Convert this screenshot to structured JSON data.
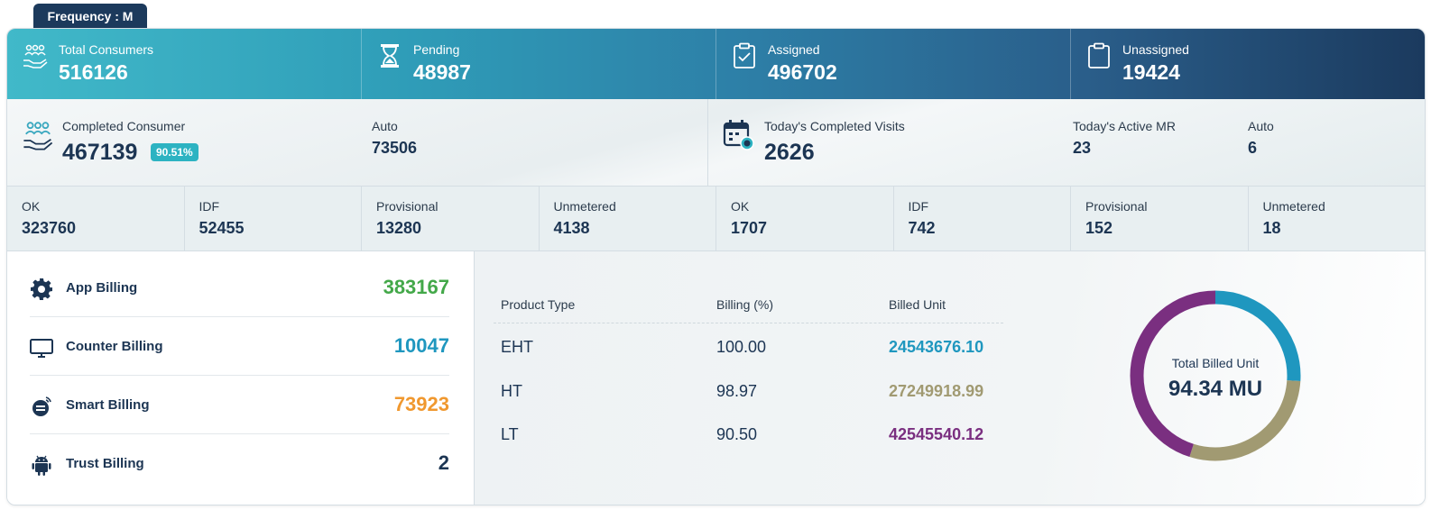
{
  "frequency_tab": "Frequency : M",
  "top_stats": [
    {
      "label": "Total Consumers",
      "value": "516126",
      "icon": "consumers-icon"
    },
    {
      "label": "Pending",
      "value": "48987",
      "icon": "hourglass-icon"
    },
    {
      "label": "Assigned",
      "value": "496702",
      "icon": "clipboard-check-icon"
    },
    {
      "label": "Unassigned",
      "value": "19424",
      "icon": "clipboard-empty-icon"
    }
  ],
  "summary": {
    "completed_label": "Completed Consumer",
    "completed_value": "467139",
    "completed_pct": "90.51%",
    "auto_label": "Auto",
    "auto_value": "73506",
    "visits_label": "Today's Completed Visits",
    "visits_value": "2626",
    "active_mr_label": "Today's Active MR",
    "active_mr_value": "23",
    "auto2_label": "Auto",
    "auto2_value": "6"
  },
  "status_row": [
    {
      "label": "OK",
      "value": "323760"
    },
    {
      "label": "IDF",
      "value": "52455"
    },
    {
      "label": "Provisional",
      "value": "13280"
    },
    {
      "label": "Unmetered",
      "value": "4138"
    },
    {
      "label": "OK",
      "value": "1707"
    },
    {
      "label": "IDF",
      "value": "742"
    },
    {
      "label": "Provisional",
      "value": "152"
    },
    {
      "label": "Unmetered",
      "value": "18"
    }
  ],
  "billing": [
    {
      "label": "App Billing",
      "value": "383167",
      "color": "#43a849",
      "icon": "gear-icon"
    },
    {
      "label": "Counter Billing",
      "value": "10047",
      "color": "#1f97bf",
      "icon": "monitor-icon"
    },
    {
      "label": "Smart Billing",
      "value": "73923",
      "color": "#f0982f",
      "icon": "smart-meter-icon"
    },
    {
      "label": "Trust Billing",
      "value": "2",
      "color": "#1c3553",
      "icon": "android-icon"
    }
  ],
  "product_table": {
    "headers": [
      "Product Type",
      "Billing (%)",
      "Billed Unit"
    ],
    "rows": [
      {
        "type": "EHT",
        "billing": "100.00",
        "unit": "24543676.10",
        "color": "#1f97bf"
      },
      {
        "type": "HT",
        "billing": "98.97",
        "unit": "27249918.99",
        "color": "#a19a72"
      },
      {
        "type": "LT",
        "billing": "90.50",
        "unit": "42545540.12",
        "color": "#7a2f80"
      }
    ]
  },
  "chart_data": {
    "type": "pie",
    "categories": [
      "EHT",
      "HT",
      "LT"
    ],
    "values": [
      24543676.1,
      27249918.99,
      42545540.12
    ],
    "colors": [
      "#1f97bf",
      "#a19a72",
      "#7a2f80"
    ],
    "center_label": "Total Billed Unit",
    "center_value": "94.34 MU"
  }
}
